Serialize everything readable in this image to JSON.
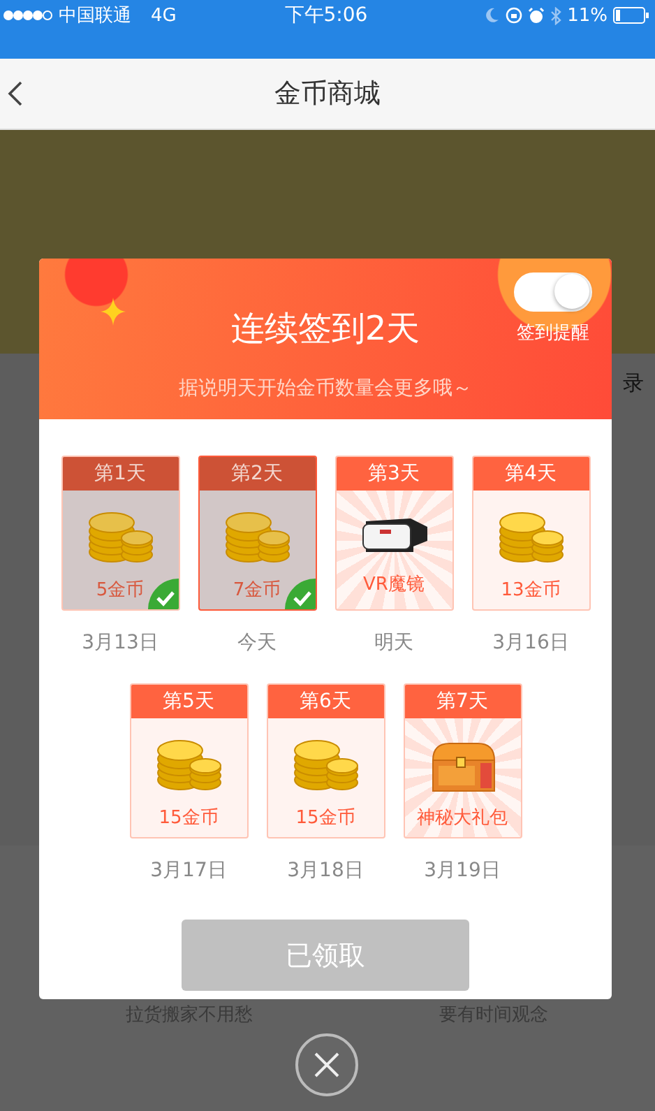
{
  "status_bar": {
    "carrier": "中国联通",
    "network": "4G",
    "time": "下午5:06",
    "battery": "11%"
  },
  "nav": {
    "title": "金币商城"
  },
  "background": {
    "side_text": "录",
    "promos": [
      {
        "subtitle": "拉货搬家不用愁"
      },
      {
        "subtitle": "要有时间观念"
      }
    ]
  },
  "modal": {
    "title": "连续签到2天",
    "subtitle": "据说明天开始金币数量会更多哦～",
    "reminder": {
      "label": "签到提醒",
      "on": true
    },
    "days": [
      {
        "label": "第1天",
        "reward": "5金币",
        "kind": "coins",
        "claimed": true,
        "selected": false,
        "date": "3月13日"
      },
      {
        "label": "第2天",
        "reward": "7金币",
        "kind": "coins",
        "claimed": true,
        "selected": true,
        "date": "今天"
      },
      {
        "label": "第3天",
        "reward": "VR魔镜",
        "kind": "vr",
        "claimed": false,
        "selected": false,
        "date": "明天"
      },
      {
        "label": "第4天",
        "reward": "13金币",
        "kind": "coins",
        "claimed": false,
        "selected": false,
        "date": "3月16日"
      },
      {
        "label": "第5天",
        "reward": "15金币",
        "kind": "coins",
        "claimed": false,
        "selected": false,
        "date": "3月17日"
      },
      {
        "label": "第6天",
        "reward": "15金币",
        "kind": "coins",
        "claimed": false,
        "selected": false,
        "date": "3月18日"
      },
      {
        "label": "第7天",
        "reward": "神秘大礼包",
        "kind": "chest",
        "claimed": false,
        "selected": false,
        "date": "3月19日"
      }
    ],
    "button": {
      "label": "已领取",
      "disabled": true
    }
  }
}
